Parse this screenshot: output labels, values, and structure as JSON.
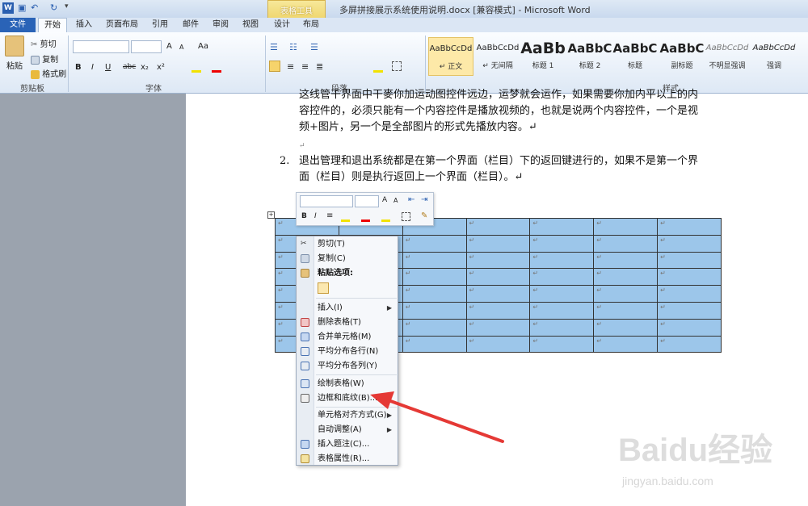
{
  "app": {
    "title": "多屏拼接展示系统使用说明.docx [兼容模式] - Microsoft Word",
    "context_tab": "表格工具"
  },
  "tabs": [
    {
      "label": "文件"
    },
    {
      "label": "开始"
    },
    {
      "label": "插入"
    },
    {
      "label": "页面布局"
    },
    {
      "label": "引用"
    },
    {
      "label": "邮件"
    },
    {
      "label": "审阅"
    },
    {
      "label": "视图"
    },
    {
      "label": "设计"
    },
    {
      "label": "布局"
    }
  ],
  "ribbon": {
    "clipboard": {
      "paste": "粘贴",
      "cut": "剪切",
      "copy": "复制",
      "format_painter": "格式刷",
      "group": "剪贴板"
    },
    "font": {
      "group": "字体",
      "grow": "A",
      "shrink": "A",
      "case": "Aa",
      "bold": "B",
      "italic": "I",
      "underline": "U",
      "strike": "abc",
      "sub": "x₂",
      "sup": "x²"
    },
    "paragraph": {
      "group": "段落"
    },
    "styles": {
      "group": "样式",
      "items": [
        {
          "sample": "AaBbCcDd",
          "label": "↵ 正文"
        },
        {
          "sample": "AaBbCcDd",
          "label": "↵ 无间隔"
        },
        {
          "sample": "AaBb",
          "label": "标题 1"
        },
        {
          "sample": "AaBbC",
          "label": "标题 2"
        },
        {
          "sample": "AaBbC",
          "label": "标题"
        },
        {
          "sample": "AaBbC",
          "label": "副标题"
        },
        {
          "sample": "AaBbCcDd",
          "label": "不明显强调"
        },
        {
          "sample": "AaBbCcDd",
          "label": "强调"
        }
      ]
    }
  },
  "document": {
    "item1_line1": "这线管干界面中干麥你加运动图控件远边，运梦就会运作，如果需要你加内平以上的内",
    "item1_line2": "容控件的，必须只能有一个内容控件是播放视频的，也就是说两个内容控件，一个是视",
    "item1_line3": "频+图片，另一个是全部图片的形式先播放内容。↵",
    "item2_num": "2.",
    "item2_line1": "退出管理和退出系统都是在第一个界面（栏目）下的返回键进行的，如果不是第一个界",
    "item2_line2": "面（栏目）则是执行返回上一个界面（栏目）。↵",
    "cell_mark": "↵",
    "table_rows": 8,
    "table_cols": 7
  },
  "context_menu": {
    "items": [
      {
        "label": "剪切(T)"
      },
      {
        "label": "复制(C)"
      },
      {
        "label": "粘贴选项:"
      },
      {
        "label": "插入(I)",
        "submenu": true
      },
      {
        "label": "删除表格(T)"
      },
      {
        "label": "合并单元格(M)"
      },
      {
        "label": "平均分布各行(N)"
      },
      {
        "label": "平均分布各列(Y)"
      },
      {
        "label": "绘制表格(W)"
      },
      {
        "label": "边框和底纹(B)..."
      },
      {
        "label": "单元格对齐方式(G)",
        "submenu": true
      },
      {
        "label": "自动调整(A)",
        "submenu": true
      },
      {
        "label": "插入题注(C)..."
      },
      {
        "label": "表格属性(R)..."
      }
    ]
  },
  "watermark": {
    "brand": "Baidu经验",
    "url": "jingyan.baidu.com"
  },
  "colors": {
    "accent": "#2a63b7",
    "selection": "#9cc6ea",
    "arrow": "#e53935"
  }
}
